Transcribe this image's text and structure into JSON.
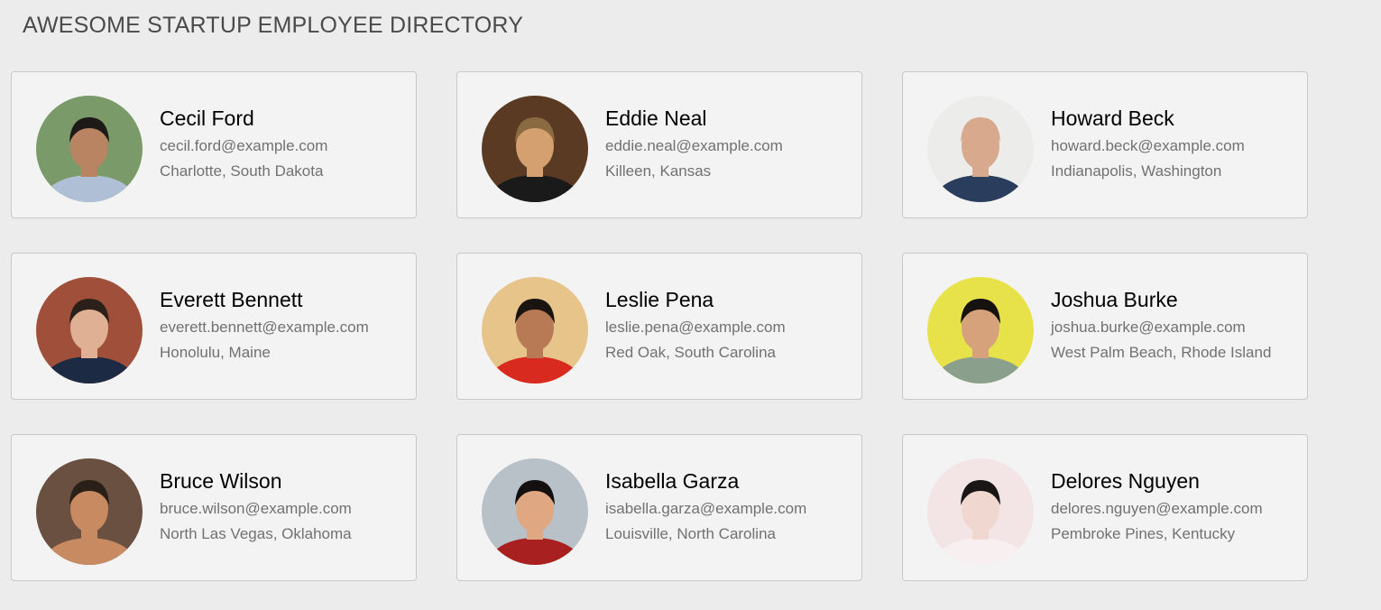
{
  "header": {
    "title": "AWESOME STARTUP EMPLOYEE DIRECTORY"
  },
  "employees": [
    {
      "name": "Cecil Ford",
      "email": "cecil.ford@example.com",
      "location": "Charlotte, South Dakota",
      "photo": {
        "bg": "#7a9a6a",
        "skin": "#b88462",
        "hair": "#1e1a18",
        "shirt": "#aebfd6"
      }
    },
    {
      "name": "Eddie Neal",
      "email": "eddie.neal@example.com",
      "location": "Killeen, Kansas",
      "photo": {
        "bg": "#5a3a22",
        "skin": "#d4a070",
        "hair": "#8a6a40",
        "shirt": "#1a1a1a"
      }
    },
    {
      "name": "Howard Beck",
      "email": "howard.beck@example.com",
      "location": "Indianapolis, Washington",
      "photo": {
        "bg": "#ecedeb",
        "skin": "#d9a98e",
        "hair": "#d9a98e",
        "shirt": "#2a3d5c"
      }
    },
    {
      "name": "Everett Bennett",
      "email": "everett.bennett@example.com",
      "location": "Honolulu, Maine",
      "photo": {
        "bg": "#a0503a",
        "skin": "#e0b094",
        "hair": "#2b211a",
        "shirt": "#1d2a44"
      }
    },
    {
      "name": "Leslie Pena",
      "email": "leslie.pena@example.com",
      "location": "Red Oak, South Carolina",
      "photo": {
        "bg": "#e6c48a",
        "skin": "#b87a55",
        "hair": "#1a1410",
        "shirt": "#d82a1e"
      }
    },
    {
      "name": "Joshua Burke",
      "email": "joshua.burke@example.com",
      "location": "West Palm Beach, Rhode Island",
      "photo": {
        "bg": "#e8e24a",
        "skin": "#d6a27c",
        "hair": "#161210",
        "shirt": "#8aa08c"
      }
    },
    {
      "name": "Bruce Wilson",
      "email": "bruce.wilson@example.com",
      "location": "North Las Vegas, Oklahoma",
      "photo": {
        "bg": "#6a5040",
        "skin": "#c88a60",
        "hair": "#2a2018",
        "shirt": "#c88a60"
      }
    },
    {
      "name": "Isabella Garza",
      "email": "isabella.garza@example.com",
      "location": "Louisville, North Carolina",
      "photo": {
        "bg": "#b8c0c8",
        "skin": "#e0a882",
        "hair": "#141010",
        "shirt": "#a82020"
      }
    },
    {
      "name": "Delores Nguyen",
      "email": "delores.nguyen@example.com",
      "location": "Pembroke Pines, Kentucky",
      "photo": {
        "bg": "#f3e4e6",
        "skin": "#f0d8d0",
        "hair": "#1a1616",
        "shirt": "#f8f0f0"
      }
    }
  ]
}
